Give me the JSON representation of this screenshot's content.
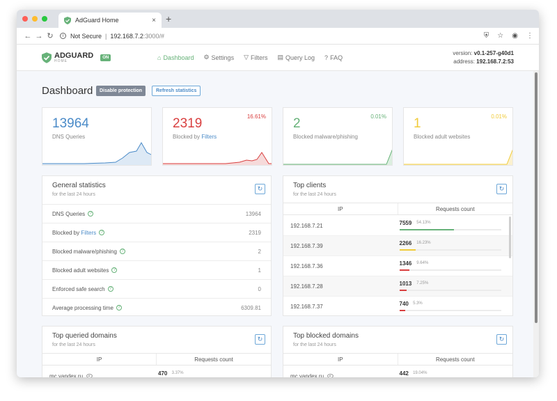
{
  "browser": {
    "tab_title": "AdGuard Home",
    "tab_close": "×",
    "new_tab": "+",
    "security": "Not Secure",
    "url_host": "192.168.7.2",
    "url_rest": ":3000/#"
  },
  "header": {
    "brand": "ADGUARD",
    "brand_sub": "HOME",
    "status_badge": "ON",
    "nav": [
      {
        "label": "Dashboard",
        "icon": "home-icon"
      },
      {
        "label": "Settings",
        "icon": "gear-icon"
      },
      {
        "label": "Filters",
        "icon": "filter-icon"
      },
      {
        "label": "Query Log",
        "icon": "document-icon"
      },
      {
        "label": "FAQ",
        "icon": "question-icon"
      }
    ],
    "version_label": "version:",
    "version_value": "v0.1-257-g40d1",
    "address_label": "address:",
    "address_value": "192.168.7.2:53"
  },
  "dashboard": {
    "title": "Dashboard",
    "disable_button": "Disable protection",
    "refresh_button": "Refresh statistics"
  },
  "stat_cards": [
    {
      "value": "13964",
      "label": "DNS Queries",
      "percent": "",
      "color": "#4b8bc8"
    },
    {
      "value": "2319",
      "label_prefix": "Blocked by ",
      "label_link": "Filters",
      "percent": "16.61%",
      "color": "#d94040"
    },
    {
      "value": "2",
      "label": "Blocked malware/phishing",
      "percent": "0.01%",
      "color": "#67b279"
    },
    {
      "value": "1",
      "label": "Blocked adult websites",
      "percent": "0.01%",
      "color": "#f0cb3a"
    }
  ],
  "general_statistics": {
    "title": "General statistics",
    "subtitle": "for the last 24 hours",
    "rows": [
      {
        "label": "DNS Queries",
        "value": "13964"
      },
      {
        "label_prefix": "Blocked by ",
        "label_link": "Filters",
        "value": "2319"
      },
      {
        "label": "Blocked malware/phishing",
        "value": "2"
      },
      {
        "label": "Blocked adult websites",
        "value": "1"
      },
      {
        "label": "Enforced safe search",
        "value": "0"
      },
      {
        "label": "Average processing time",
        "value": "6309.81"
      }
    ]
  },
  "top_clients": {
    "title": "Top clients",
    "subtitle": "for the last 24 hours",
    "col_ip": "IP",
    "col_requests": "Requests count",
    "rows": [
      {
        "ip": "192.168.7.21",
        "count": "7559",
        "percent": "54.13%",
        "fraction": 0.54,
        "color": "#67b279"
      },
      {
        "ip": "192.168.7.39",
        "count": "2266",
        "percent": "16.23%",
        "fraction": 0.16,
        "color": "#f0cb3a"
      },
      {
        "ip": "192.168.7.36",
        "count": "1346",
        "percent": "9.64%",
        "fraction": 0.1,
        "color": "#d94040"
      },
      {
        "ip": "192.168.7.28",
        "count": "1013",
        "percent": "7.25%",
        "fraction": 0.07,
        "color": "#d94040"
      },
      {
        "ip": "192.168.7.37",
        "count": "740",
        "percent": "5.3%",
        "fraction": 0.05,
        "color": "#d94040"
      }
    ]
  },
  "top_queried": {
    "title": "Top queried domains",
    "subtitle": "for the last 24 hours",
    "col_ip": "IP",
    "col_requests": "Requests count",
    "rows": [
      {
        "domain": "mc.yandex.ru",
        "count": "470",
        "percent": "3.37%",
        "fraction": 0.03,
        "color": "#67b279"
      }
    ]
  },
  "top_blocked": {
    "title": "Top blocked domains",
    "subtitle": "for the last 24 hours",
    "col_ip": "IP",
    "col_requests": "Requests count",
    "rows": [
      {
        "domain": "mc.yandex.ru",
        "count": "442",
        "percent": "19.04%",
        "fraction": 0.19,
        "color": "#d94040"
      }
    ]
  }
}
